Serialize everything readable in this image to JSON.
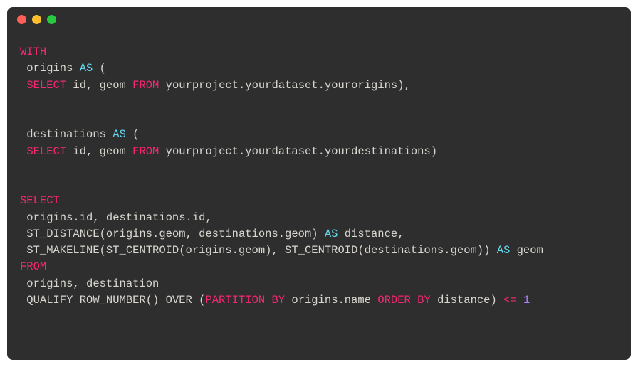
{
  "code": {
    "tokens": [
      [
        {
          "t": "WITH",
          "c": "kw"
        }
      ],
      [
        {
          "t": " origins ",
          "c": "id"
        },
        {
          "t": "AS",
          "c": "fn"
        },
        {
          "t": " (",
          "c": "id"
        }
      ],
      [
        {
          "t": " ",
          "c": "id"
        },
        {
          "t": "SELECT",
          "c": "kw"
        },
        {
          "t": " id, geom ",
          "c": "id"
        },
        {
          "t": "FROM",
          "c": "kw"
        },
        {
          "t": " yourproject.yourdataset.yourorigins),",
          "c": "id"
        }
      ],
      [],
      [],
      [
        {
          "t": " destinations ",
          "c": "id"
        },
        {
          "t": "AS",
          "c": "fn"
        },
        {
          "t": " (",
          "c": "id"
        }
      ],
      [
        {
          "t": " ",
          "c": "id"
        },
        {
          "t": "SELECT",
          "c": "kw"
        },
        {
          "t": " id, geom ",
          "c": "id"
        },
        {
          "t": "FROM",
          "c": "kw"
        },
        {
          "t": " yourproject.yourdataset.yourdestinations)",
          "c": "id"
        }
      ],
      [],
      [],
      [
        {
          "t": "SELECT",
          "c": "kw"
        }
      ],
      [
        {
          "t": " origins.id, destinations.id,",
          "c": "id"
        }
      ],
      [
        {
          "t": " ST_DISTANCE(origins.geom, destinations.geom) ",
          "c": "id"
        },
        {
          "t": "AS",
          "c": "fn"
        },
        {
          "t": " distance,",
          "c": "id"
        }
      ],
      [
        {
          "t": " ST_MAKELINE(ST_CENTROID(origins.geom), ST_CENTROID(destinations.geom)) ",
          "c": "id"
        },
        {
          "t": "AS",
          "c": "fn"
        },
        {
          "t": " geom",
          "c": "id"
        }
      ],
      [
        {
          "t": "FROM",
          "c": "kw"
        }
      ],
      [
        {
          "t": " origins, destination",
          "c": "id"
        }
      ],
      [
        {
          "t": " QUALIFY ROW_NUMBER() OVER (",
          "c": "id"
        },
        {
          "t": "PARTITION",
          "c": "kw"
        },
        {
          "t": " ",
          "c": "id"
        },
        {
          "t": "BY",
          "c": "kw"
        },
        {
          "t": " origins.name ",
          "c": "id"
        },
        {
          "t": "ORDER",
          "c": "kw"
        },
        {
          "t": " ",
          "c": "id"
        },
        {
          "t": "BY",
          "c": "kw"
        },
        {
          "t": " distance) ",
          "c": "id"
        },
        {
          "t": "<=",
          "c": "op"
        },
        {
          "t": " ",
          "c": "id"
        },
        {
          "t": "1",
          "c": "num"
        }
      ]
    ]
  }
}
